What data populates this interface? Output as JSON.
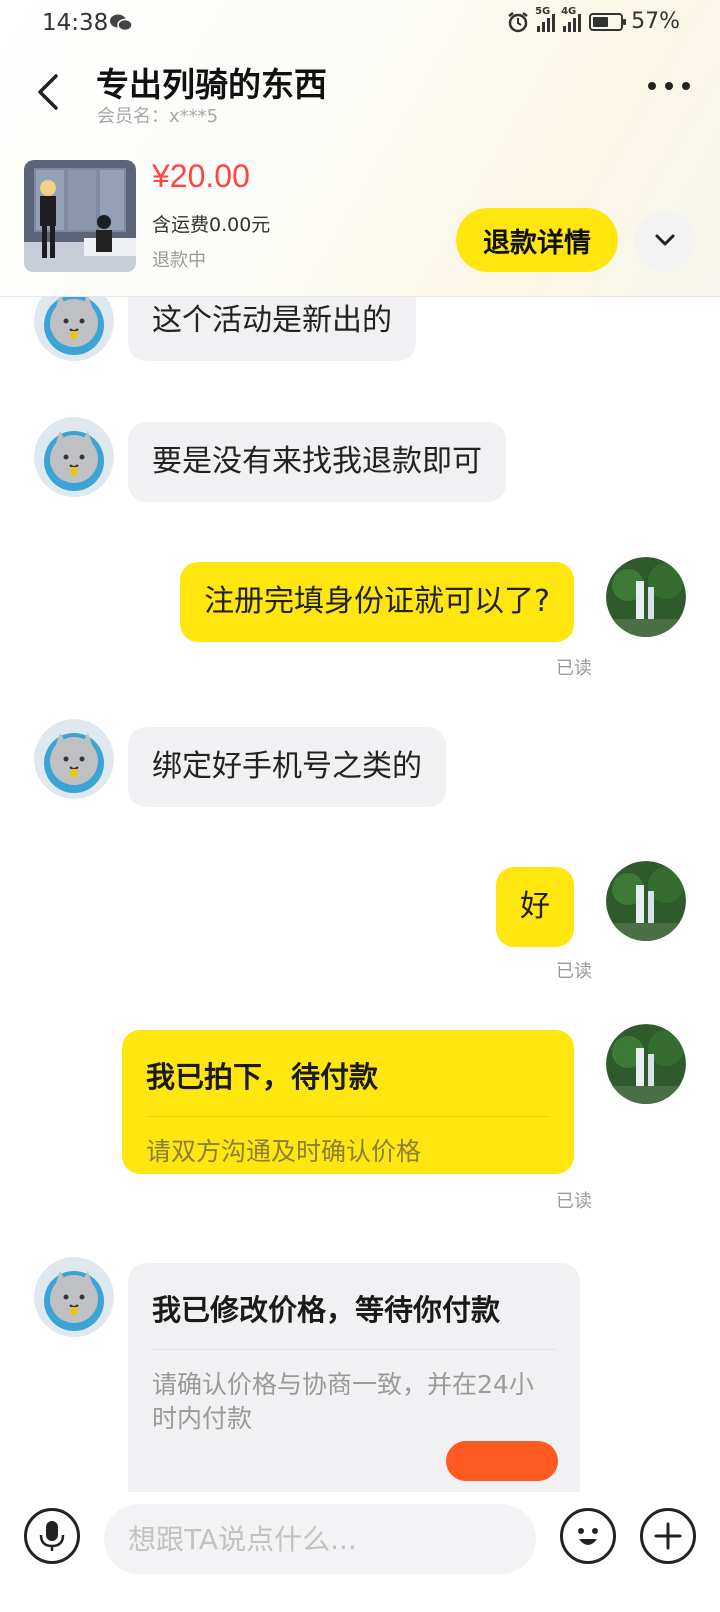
{
  "status_bar": {
    "time": "14:38",
    "signal1_tag": "5G",
    "signal2_tag": "4G",
    "battery": "57%",
    "battery_level": 0.57
  },
  "header": {
    "title": "专出列骑的东西",
    "member": "会员名：x***5"
  },
  "product": {
    "price": "¥20.00",
    "shipping": "含运费0.00元",
    "status": "退款中",
    "refund_button": "退款详情"
  },
  "messages": [
    {
      "side": "them",
      "text": "这个活动是新出的"
    },
    {
      "side": "them",
      "text": "要是没有来找我退款即可"
    },
    {
      "side": "me",
      "text": "注册完填身份证就可以了?",
      "read": "已读"
    },
    {
      "side": "them",
      "text": "绑定好手机号之类的"
    },
    {
      "side": "me",
      "text": "好",
      "read": "已读"
    }
  ],
  "order_card": {
    "title": "我已拍下，待付款",
    "subtitle": "请双方沟通及时确认价格",
    "read": "已读"
  },
  "price_card": {
    "title": "我已修改价格，等待你付款",
    "subtitle_line1": "请确认价格与协商一致，并在24小",
    "subtitle_line2": "时内付款"
  },
  "composer": {
    "placeholder": "想跟TA说点什么..."
  },
  "colors": {
    "accent": "#ffe60f",
    "price": "#ff4444",
    "pay": "#ff5a1f"
  }
}
